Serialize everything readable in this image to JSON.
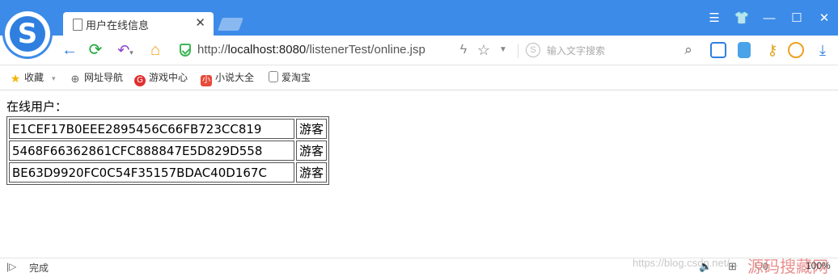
{
  "browser": {
    "tab_title": "用户在线信息",
    "address_url_prefix": "http://",
    "address_url_host": "localhost:8080",
    "address_url_path": "/listenerTest/online.jsp",
    "search_placeholder": "输入文字搜索",
    "accent_color": "#3d8be8"
  },
  "bookmarks": [
    {
      "label": "收藏",
      "icon": "star-icon"
    },
    {
      "label": "网址导航",
      "icon": "globe-icon"
    },
    {
      "label": "游戏中心",
      "icon": "game-icon"
    },
    {
      "label": "小说大全",
      "icon": "book-icon"
    },
    {
      "label": "爱淘宝",
      "icon": "page-icon"
    }
  ],
  "page": {
    "heading": "在线用户：",
    "users": [
      {
        "session_id": "E1CEF17B0EEE2895456C66FB723CC819",
        "role": "游客"
      },
      {
        "session_id": "5468F66362861CFC888847E5D829D558",
        "role": "游客"
      },
      {
        "session_id": "BE63D9920FC0C54F35157BDAC40D167C",
        "role": "游客"
      }
    ]
  },
  "status": {
    "text": "完成",
    "zoom": "100%",
    "count": "0",
    "watermark": "https://blog.csdn.net/...",
    "watermark_cn": "源码搜藏网"
  }
}
